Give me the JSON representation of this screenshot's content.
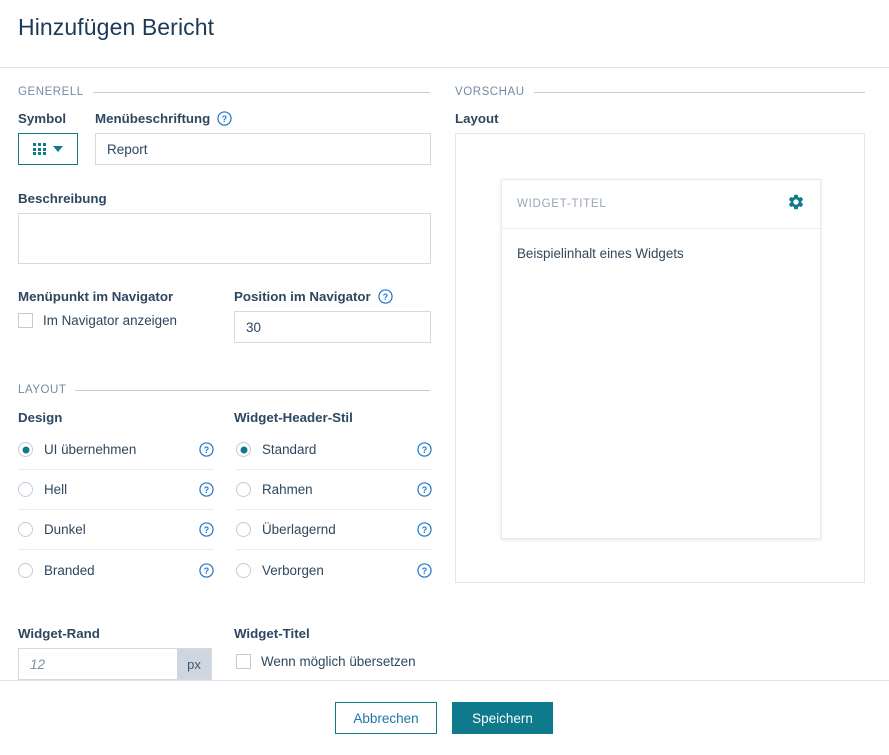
{
  "header": {
    "title": "Hinzufügen Bericht"
  },
  "sections": {
    "general_label": "GENERELL",
    "layout_label": "LAYOUT",
    "preview_label": "VORSCHAU"
  },
  "general": {
    "symbol_label": "Symbol",
    "symbol_icon": "grid-3x3-icon",
    "symbol_caret_icon": "chevron-down-icon",
    "menu_caption_label": "Menübeschriftung",
    "menu_caption_value": "Report",
    "menu_caption_placeholder": "",
    "description_label": "Beschreibung",
    "description_value": "",
    "description_placeholder": "",
    "navigator_item_label": "Menüpunkt im Navigator",
    "navigator_show_label": "Im Navigator anzeigen",
    "navigator_show_checked": false,
    "navigator_position_label": "Position im Navigator",
    "navigator_position_value": "30",
    "navigator_position_placeholder": ""
  },
  "layout": {
    "design_label": "Design",
    "design_options": [
      {
        "label": "UI übernehmen",
        "selected": true
      },
      {
        "label": "Hell",
        "selected": false
      },
      {
        "label": "Dunkel",
        "selected": false
      },
      {
        "label": "Branded",
        "selected": false
      }
    ],
    "widget_header_style_label": "Widget-Header-Stil",
    "widget_header_style_options": [
      {
        "label": "Standard",
        "selected": true
      },
      {
        "label": "Rahmen",
        "selected": false
      },
      {
        "label": "Überlagernd",
        "selected": false
      },
      {
        "label": "Verborgen",
        "selected": false
      }
    ],
    "widget_margin_label": "Widget-Rand",
    "widget_margin_value": "",
    "widget_margin_placeholder": "12",
    "widget_margin_unit": "px",
    "widget_title_label": "Widget-Titel",
    "widget_translate_label": "Wenn möglich übersetzen",
    "widget_translate_checked": false
  },
  "preview": {
    "layout_label": "Layout",
    "widget_title": "WIDGET-TITEL",
    "widget_gear_icon": "gear-icon",
    "widget_content": "Beispielinhalt eines Widgets"
  },
  "footer": {
    "cancel_label": "Abbrechen",
    "save_label": "Speichern"
  },
  "colors": {
    "accent_teal": "#0f7a8c",
    "link_blue": "#2176a8",
    "title_navy": "#1b3a57",
    "text": "#2e4760",
    "muted": "#7489a6",
    "border": "#d4dae1"
  },
  "help_icon": "help-circle-icon"
}
